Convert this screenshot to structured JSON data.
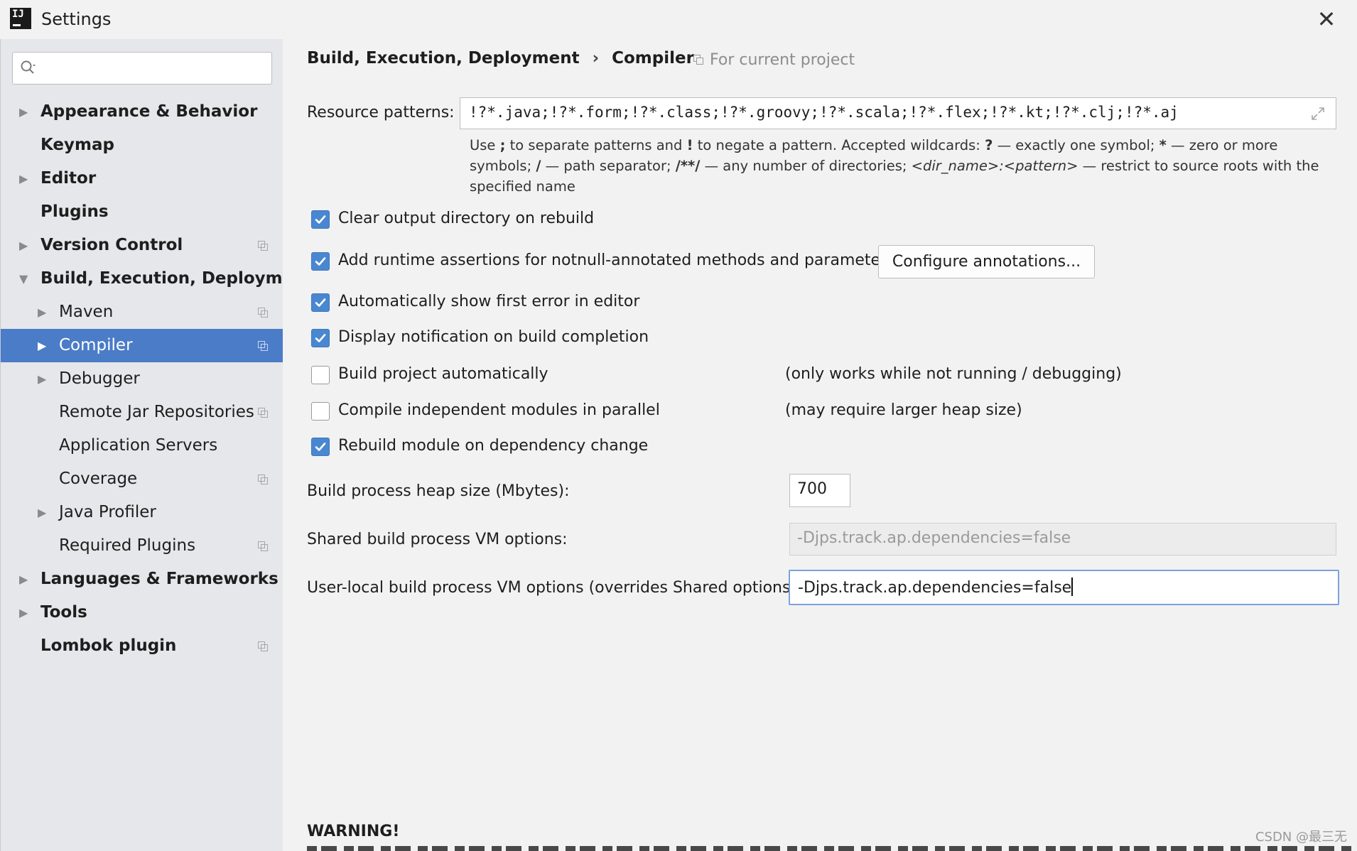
{
  "window": {
    "title": "Settings",
    "icon": "intellij-idea-icon",
    "close_glyph": "✕"
  },
  "sidebar": {
    "search": {
      "value": "",
      "placeholder": ""
    },
    "items": [
      {
        "label": "Appearance & Behavior",
        "bold": true,
        "expander": "collapsed",
        "level": 0,
        "project": false
      },
      {
        "label": "Keymap",
        "bold": true,
        "expander": "none",
        "level": 0,
        "project": false
      },
      {
        "label": "Editor",
        "bold": true,
        "expander": "collapsed",
        "level": 0,
        "project": false
      },
      {
        "label": "Plugins",
        "bold": true,
        "expander": "none",
        "level": 0,
        "project": false
      },
      {
        "label": "Version Control",
        "bold": true,
        "expander": "collapsed",
        "level": 0,
        "project": true
      },
      {
        "label": "Build, Execution, Deployment",
        "bold": true,
        "expander": "expanded",
        "level": 0,
        "project": false
      },
      {
        "label": "Maven",
        "bold": false,
        "expander": "collapsed",
        "level": 1,
        "project": true
      },
      {
        "label": "Compiler",
        "bold": false,
        "expander": "collapsed",
        "level": 1,
        "project": true,
        "selected": true
      },
      {
        "label": "Debugger",
        "bold": false,
        "expander": "collapsed",
        "level": 1,
        "project": false
      },
      {
        "label": "Remote Jar Repositories",
        "bold": false,
        "expander": "none",
        "level": 1,
        "project": true
      },
      {
        "label": "Application Servers",
        "bold": false,
        "expander": "none",
        "level": 1,
        "project": false
      },
      {
        "label": "Coverage",
        "bold": false,
        "expander": "none",
        "level": 1,
        "project": true
      },
      {
        "label": "Java Profiler",
        "bold": false,
        "expander": "collapsed",
        "level": 1,
        "project": false
      },
      {
        "label": "Required Plugins",
        "bold": false,
        "expander": "none",
        "level": 1,
        "project": true
      },
      {
        "label": "Languages & Frameworks",
        "bold": true,
        "expander": "collapsed",
        "level": 0,
        "project": false
      },
      {
        "label": "Tools",
        "bold": true,
        "expander": "collapsed",
        "level": 0,
        "project": false
      },
      {
        "label": "Lombok plugin",
        "bold": true,
        "expander": "none",
        "level": 0,
        "project": true
      }
    ]
  },
  "main": {
    "breadcrumb": {
      "parent": "Build, Execution, Deployment",
      "separator": "›",
      "current": "Compiler"
    },
    "scope_note": "For current project",
    "resource_patterns": {
      "label": "Resource patterns:",
      "value": "!?*.java;!?*.form;!?*.class;!?*.groovy;!?*.scala;!?*.flex;!?*.kt;!?*.clj;!?*.aj"
    },
    "hint": {
      "p1": "Use ",
      "sym1": ";",
      "p2": " to separate patterns and ",
      "sym2": "!",
      "p3": " to negate a pattern. Accepted wildcards: ",
      "sym3": "?",
      "p4": " — exactly one symbol; ",
      "sym4": "*",
      "p5": " — zero or more symbols; ",
      "sym5": "/",
      "p6": " — path separator; ",
      "sym6": "/**/",
      "p7": " — any number of directories; ",
      "sym7": "<dir_name>:<pattern>",
      "p8": " — restrict to source roots with the specified name"
    },
    "checkboxes": [
      {
        "label": "Clear output directory on rebuild",
        "checked": true,
        "note": ""
      },
      {
        "label": "Add runtime assertions for notnull-annotated methods and parameters",
        "checked": true,
        "note": ""
      },
      {
        "label": "Automatically show first error in editor",
        "checked": true,
        "note": ""
      },
      {
        "label": "Display notification on build completion",
        "checked": true,
        "note": ""
      },
      {
        "label": "Build project automatically",
        "checked": false,
        "note": "(only works while not running / debugging)"
      },
      {
        "label": "Compile independent modules in parallel",
        "checked": false,
        "note": "(may require larger heap size)"
      },
      {
        "label": "Rebuild module on dependency change",
        "checked": true,
        "note": ""
      }
    ],
    "configure_button": "Configure annotations...",
    "heap": {
      "label": "Build process heap size (Mbytes):",
      "value": "700"
    },
    "shared_vm": {
      "label": "Shared build process VM options:",
      "value": "-Djps.track.ap.dependencies=false"
    },
    "local_vm": {
      "label": "User-local build process VM options (overrides Shared options):",
      "value": "-Djps.track.ap.dependencies=false"
    },
    "warning": "WARNING!"
  },
  "watermark": "CSDN @最三无",
  "colors": {
    "selection": "#4a7cc7",
    "checkbox": "#4a87d1",
    "sidebar_bg": "#e6e7ea",
    "panel_bg": "#f2f2f2",
    "focus_border": "#7aa3dc"
  }
}
